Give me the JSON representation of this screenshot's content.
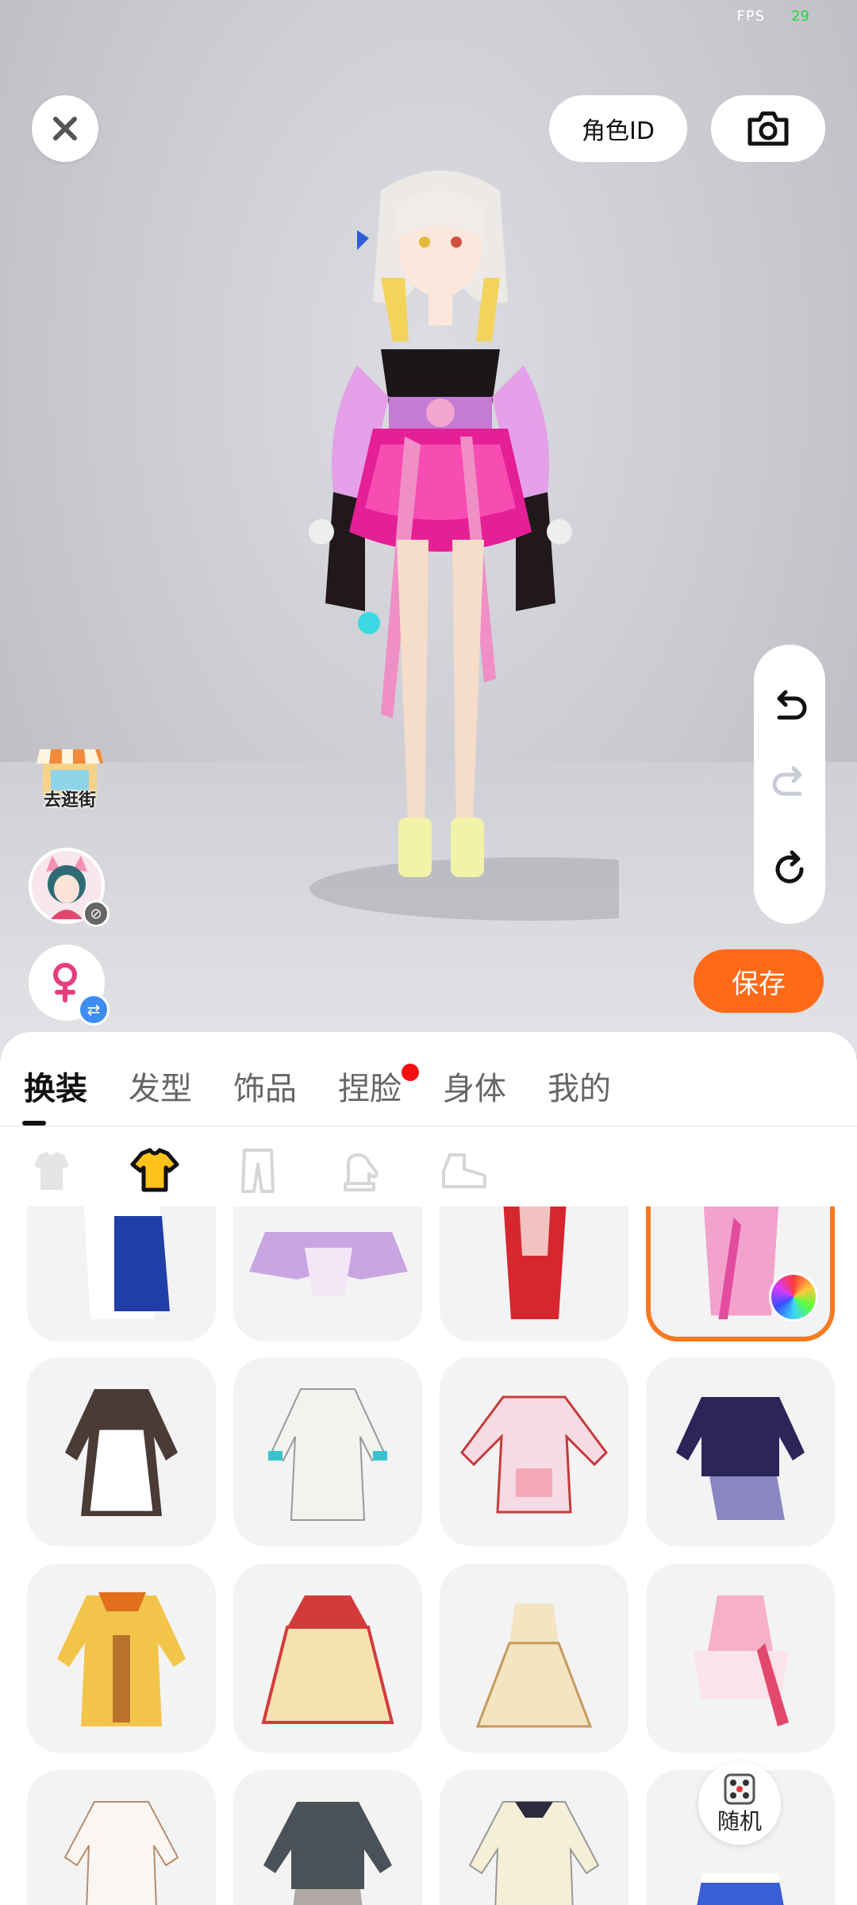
{
  "fps": {
    "label": "FPS",
    "value": "29"
  },
  "header": {
    "role_id_label": "角色ID"
  },
  "left_actions": {
    "shop_label": "去逛街"
  },
  "save_label": "保存",
  "tabs": [
    {
      "label": "换装",
      "active": true
    },
    {
      "label": "发型",
      "active": false
    },
    {
      "label": "饰品",
      "active": false
    },
    {
      "label": "捏脸",
      "active": false,
      "badge": true
    },
    {
      "label": "身体",
      "active": false
    },
    {
      "label": "我的",
      "active": false
    }
  ],
  "subcategories": [
    "set-icon",
    "top-icon",
    "bottom-icon",
    "glove-icon",
    "shoe-icon"
  ],
  "active_subcategory": "top-icon",
  "outfits": [
    {
      "name": "blue-white-dress",
      "colors": [
        "#1f3fa6",
        "#ffffff"
      ]
    },
    {
      "name": "lavender-dress",
      "colors": [
        "#c9a6e2",
        "#f3e6f7"
      ]
    },
    {
      "name": "red-dress",
      "colors": [
        "#d6262e",
        "#f2c2c0"
      ]
    },
    {
      "name": "pink-current-outfit",
      "colors": [
        "#f3a2cc",
        "#e24c9e"
      ],
      "selected": true
    },
    {
      "name": "maid-dress",
      "colors": [
        "#4a3b36",
        "#ffffff"
      ]
    },
    {
      "name": "white-teal-dress",
      "colors": [
        "#f2f2ee",
        "#36c4cf"
      ]
    },
    {
      "name": "pink-white-jacket",
      "colors": [
        "#f7dbe4",
        "#c43b3b"
      ]
    },
    {
      "name": "navy-sweater-plaid",
      "colors": [
        "#2c2558",
        "#8a86c4"
      ]
    },
    {
      "name": "yellow-coat",
      "colors": [
        "#f2c54a",
        "#e26f1b"
      ]
    },
    {
      "name": "red-cream-gown",
      "colors": [
        "#d33b3b",
        "#f4e2b0"
      ]
    },
    {
      "name": "cream-gown",
      "colors": [
        "#f3e4c2",
        "#c79a5c"
      ]
    },
    {
      "name": "pink-frill-dress",
      "colors": [
        "#f6b0c8",
        "#e2486e"
      ]
    },
    {
      "name": "white-long-dress",
      "colors": [
        "#fbf6f2",
        "#b48c6c"
      ]
    },
    {
      "name": "gray-uniform",
      "colors": [
        "#4b5158",
        "#b0a8a4"
      ]
    },
    {
      "name": "cream-cardigan",
      "colors": [
        "#f5efd8",
        "#2c2a3c"
      ]
    },
    {
      "name": "blue-skirt",
      "colors": [
        "#3a5ed6",
        "#ffffff"
      ]
    }
  ],
  "random_label": "随机",
  "colors": {
    "accent": "#ff6a18",
    "selected_border": "#f5791f",
    "badge_red": "#f41010"
  }
}
